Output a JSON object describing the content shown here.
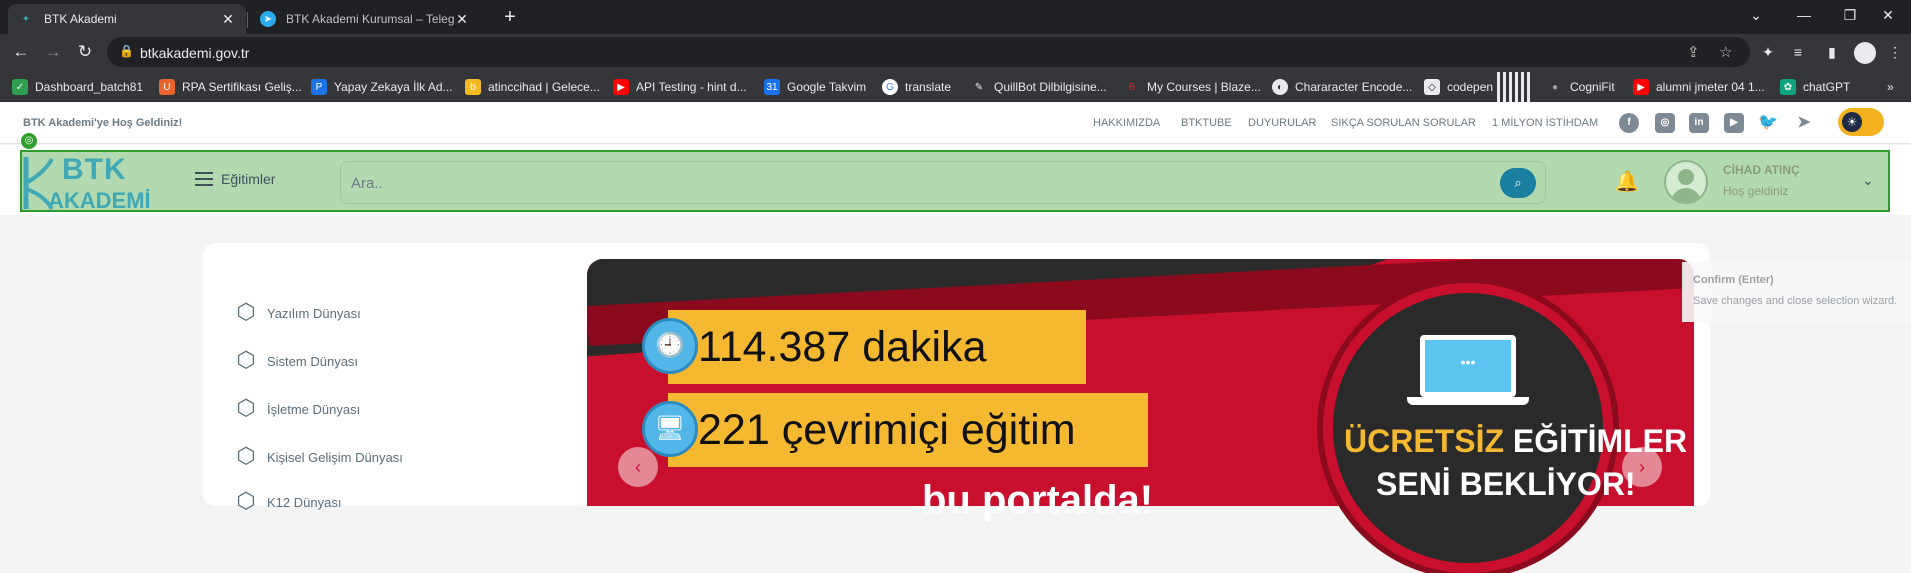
{
  "browser": {
    "tabs": [
      {
        "title": "BTK Akademi",
        "favicon": "btk-favicon",
        "active": true
      },
      {
        "title": "BTK Akademi Kurumsal – Telegram",
        "favicon": "telegram-favicon",
        "active": false
      }
    ],
    "url": "btkakademi.gov.tr",
    "bookmarks": [
      {
        "label": "Dashboard_batch81",
        "icon": "green-icon",
        "color": "#2e9e4f"
      },
      {
        "label": "RPA Sertifikası Geliş...",
        "icon": "orange-icon",
        "color": "#e8642b"
      },
      {
        "label": "Yapay Zekaya İlk Ad...",
        "icon": "blue-icon",
        "color": "#1a73e8"
      },
      {
        "label": "atinccihad | Gelece...",
        "icon": "yellow-icon",
        "color": "#f5b920"
      },
      {
        "label": "API Testing - hint d...",
        "icon": "youtube-icon",
        "color": "#ff0000"
      },
      {
        "label": "Google Takvim",
        "icon": "calendar-icon",
        "color": "#1a73e8"
      },
      {
        "label": "translate",
        "icon": "google-icon",
        "color": "#4285f4"
      },
      {
        "label": "QuillBot Dilbilgisine...",
        "icon": "quill-icon",
        "color": "#5f6368"
      },
      {
        "label": "My Courses | Blaze...",
        "icon": "blaze-icon",
        "color": "#c62828"
      },
      {
        "label": "Chararacter Encode...",
        "icon": "globe-icon",
        "color": "#5f6368"
      },
      {
        "label": "codepen",
        "icon": "codepen-icon",
        "color": "#202124"
      },
      {
        "label": "CogniFit",
        "icon": "mic-icon",
        "color": "#5f6368"
      },
      {
        "label": "alumni jmeter 04 1...",
        "icon": "youtube-icon",
        "color": "#ff0000"
      },
      {
        "label": "chatGPT",
        "icon": "chatgpt-icon",
        "color": "#10a37f"
      }
    ]
  },
  "site": {
    "welcome": "BTK Akademi'ye Hoş Geldiniz!",
    "top_links": [
      "HAKKIMIZDA",
      "BTKTUBE",
      "DUYURULAR",
      "SIKÇA SORULAN SORULAR",
      "1 MİLYON İSTİHDAM"
    ],
    "logo_top": "BTK",
    "logo_bottom": "AKADEMİ",
    "menu_label": "Eğitimler",
    "search_placeholder": "Ara..",
    "user_name": "CİHAD ATINÇ",
    "user_greeting": "Hoş geldiniz",
    "categories": [
      "Yazılım Dünyası",
      "Sistem Dünyası",
      "İşletme Dünyası",
      "Kişisel Gelişim Dünyası",
      "K12 Dünyası"
    ]
  },
  "banner": {
    "stat1": "114.387 dakika",
    "stat2": "221 çevrimiçi eğitim",
    "portal_text": "bu portalda!",
    "free_highlight": "ÜCRETSİZ",
    "free_rest": " EĞİTİMLER",
    "free_line2": "SENİ BEKLİYOR!"
  },
  "tooltip": {
    "title": "Confirm (Enter)",
    "text": "Save changes and close selection wizard."
  },
  "colors": {
    "accent": "#3fa9b5",
    "highlight": "#b3d9b0",
    "banner_red": "#c8102e",
    "banner_yellow": "#f5b931"
  }
}
